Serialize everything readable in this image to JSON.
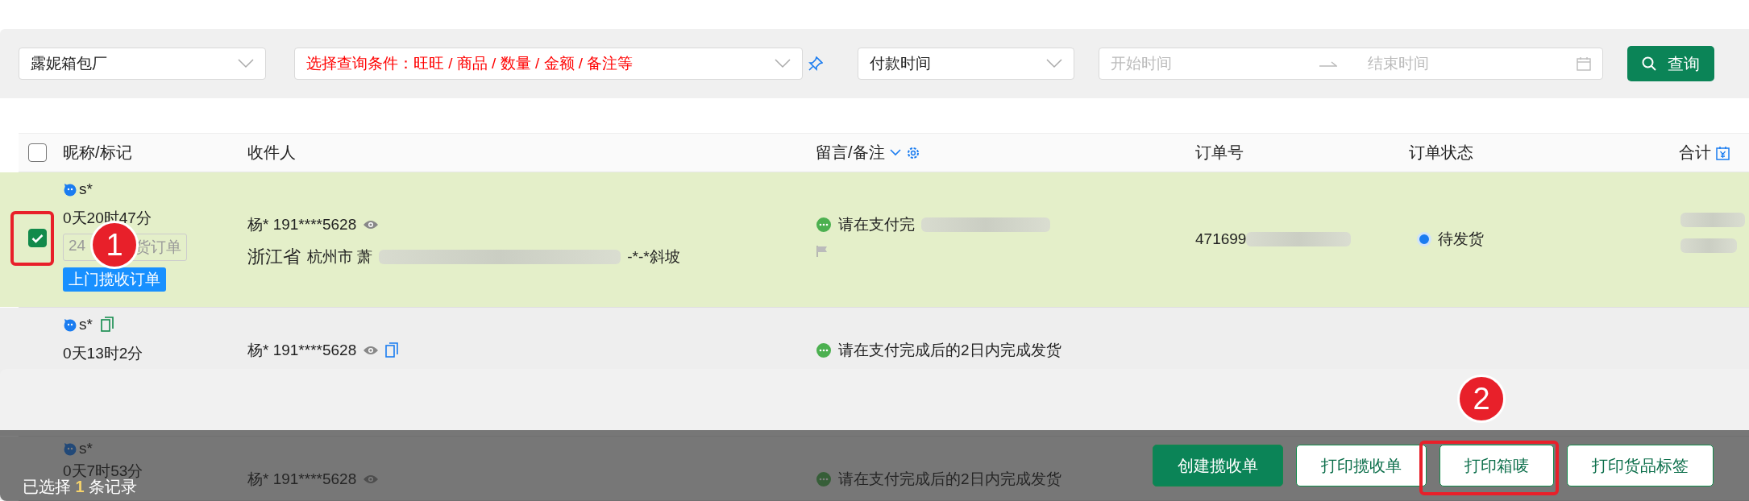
{
  "filters": {
    "shop": {
      "value": "露妮箱包厂"
    },
    "query_condition": {
      "placeholder": "选择查询条件：旺旺 / 商品 / 数量 / 金额 / 备注等"
    },
    "time_type": {
      "value": "付款时间"
    },
    "date_range": {
      "start_placeholder": "开始时间",
      "end_placeholder": "结束时间"
    },
    "search_button": "查询"
  },
  "table": {
    "select_all": {
      "checked": false
    },
    "columns": [
      "昵称/标记",
      "收件人",
      "留言/备注",
      "订单号",
      "订单状态",
      "合计"
    ],
    "rows": [
      {
        "kind": "full",
        "selected": true,
        "nickname": "s*",
        "copy_icon": false,
        "time": "0天20时47分",
        "tags": [
          {
            "kind": "outline",
            "text_start": "24",
            "text_end": "货订单"
          },
          {
            "kind": "filled",
            "text": "上门揽收订单"
          }
        ],
        "recipient": "杨* 191****5628",
        "recipient_copy_icon": false,
        "province": "浙江省",
        "address_start": "杭州市 萧",
        "address_end": "-*-*斜坡",
        "message": "请在支付完",
        "flag": true,
        "order_no": "471699",
        "status": "待发货",
        "status_checked": true,
        "redacted": true
      },
      {
        "kind": "partial",
        "selected": false,
        "nickname": "s*",
        "copy_icon": true,
        "time": "0天13时2分",
        "recipient": "杨* 191****5628",
        "recipient_copy_icon": true,
        "message": "请在支付完成后的2日内完成发货",
        "flag": false,
        "redacted": false
      },
      {
        "kind": "partial",
        "selected": false,
        "nickname": "s*",
        "copy_icon": false,
        "time": "0天7时53分",
        "recipient": "杨* 191****5628",
        "recipient_copy_icon": false,
        "message": "请在支付完成后的2日内完成发货",
        "flag": false,
        "redacted": false
      }
    ]
  },
  "action_bar": {
    "selection": "已选择 **1** 条记录",
    "buttons": [
      {
        "label": "创建揽收单",
        "kind": "primary"
      },
      {
        "label": "打印揽收单",
        "kind": "outline"
      },
      {
        "label": "打印箱唛",
        "kind": "outline"
      },
      {
        "label": "打印货品标签",
        "kind": "outline"
      }
    ]
  },
  "annotations": [
    {
      "label": "1"
    },
    {
      "label": "2"
    }
  ]
}
